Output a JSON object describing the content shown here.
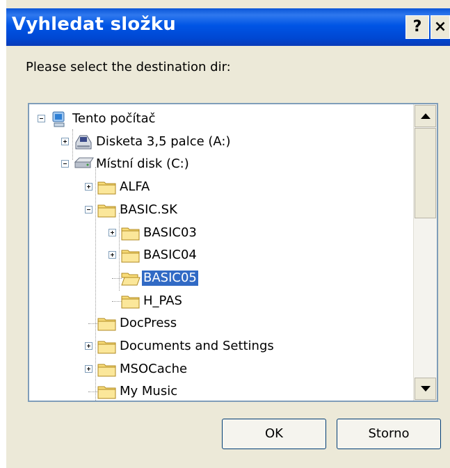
{
  "window": {
    "title": "Vyhledat složku",
    "help_label": "?",
    "close_label": "×"
  },
  "prompt": "Please select the destination dir:",
  "tree": {
    "items": [
      {
        "label": "Tento počítač",
        "icon": "computer-icon",
        "expander": "minus",
        "level": 0
      },
      {
        "label": "Disketa 3,5 palce (A:)",
        "icon": "floppy-drive-icon",
        "expander": "plus",
        "level": 1
      },
      {
        "label": "Místní disk (C:)",
        "icon": "hard-drive-icon",
        "expander": "minus",
        "level": 1
      },
      {
        "label": "ALFA",
        "icon": "folder-icon",
        "expander": "plus",
        "level": 2
      },
      {
        "label": "BASIC.SK",
        "icon": "folder-icon",
        "expander": "minus",
        "level": 2
      },
      {
        "label": "BASIC03",
        "icon": "folder-icon",
        "expander": "plus",
        "level": 3
      },
      {
        "label": "BASIC04",
        "icon": "folder-icon",
        "expander": "plus",
        "level": 3
      },
      {
        "label": "BASIC05",
        "icon": "open-folder-icon",
        "expander": "none",
        "level": 3,
        "selected": true
      },
      {
        "label": "H_PAS",
        "icon": "folder-icon",
        "expander": "none",
        "level": 3
      },
      {
        "label": "DocPress",
        "icon": "folder-icon",
        "expander": "none",
        "level": 2
      },
      {
        "label": "Documents and Settings",
        "icon": "folder-icon",
        "expander": "plus",
        "level": 2
      },
      {
        "label": "MSOCache",
        "icon": "folder-icon",
        "expander": "plus",
        "level": 2
      },
      {
        "label": "My Music",
        "icon": "folder-icon",
        "expander": "none",
        "level": 2
      }
    ]
  },
  "buttons": {
    "ok": "OK",
    "cancel": "Storno"
  },
  "colors": {
    "titlebar": "#0055e5",
    "selection": "#316ac5",
    "dialog_bg": "#ece9d8"
  }
}
